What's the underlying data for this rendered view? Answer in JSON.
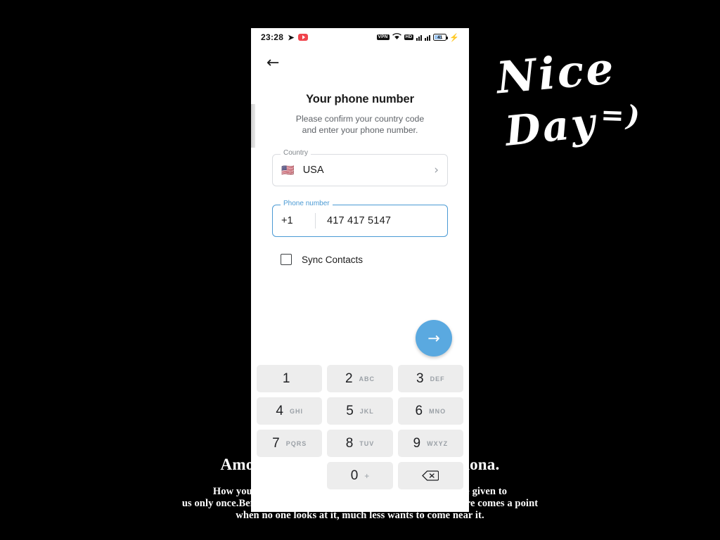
{
  "background": {
    "tagline": "Amor con amor se paga, amar perdona.",
    "paragraph_lines": [
      "How you live your life is your business, and our bodies are given to",
      "us only once.Before you know it,  health leaves ; as your body there comes a point",
      "when no one looks at it,  much less wants to come near it."
    ],
    "handwriting_line1": "Nice",
    "handwriting_line2": "Day",
    "handwriting_smiley": "=)"
  },
  "statusbar": {
    "time": "23:28",
    "telegram_icon": "telegram-icon",
    "youtube_icon": "youtube-icon",
    "vpn_label": "VPN",
    "wifi_icon": "wifi-icon",
    "hd_label": "HD",
    "signal1_icon": "signal-bars-icon",
    "signal2_icon": "signal-bars-icon",
    "battery_level": "41",
    "charging_icon": "bolt-icon"
  },
  "nav": {
    "back_label": "←"
  },
  "screen": {
    "title": "Your phone number",
    "subtitle_line1": "Please confirm your country code",
    "subtitle_line2": "and enter your phone number.",
    "country_field": {
      "label": "Country",
      "flag": "🇺🇸",
      "value": "USA",
      "chevron": "›"
    },
    "phone_field": {
      "label": "Phone number",
      "dial_code": "+1",
      "value": "417 417 5147",
      "placeholder": "Phone number"
    },
    "sync_contacts": {
      "label": "Sync Contacts",
      "checked": false
    },
    "next_button": {
      "icon": "arrow-right-icon",
      "glyph": "→",
      "color": "#5aa9e0"
    }
  },
  "keypad": {
    "rows": [
      [
        {
          "num": "1",
          "sub": ""
        },
        {
          "num": "2",
          "sub": "ABC"
        },
        {
          "num": "3",
          "sub": "DEF"
        }
      ],
      [
        {
          "num": "4",
          "sub": "GHI"
        },
        {
          "num": "5",
          "sub": "JKL"
        },
        {
          "num": "6",
          "sub": "MNO"
        }
      ],
      [
        {
          "num": "7",
          "sub": "PQRS"
        },
        {
          "num": "8",
          "sub": "TUV"
        },
        {
          "num": "9",
          "sub": "WXYZ"
        }
      ]
    ],
    "bottom": {
      "zero": "0",
      "plus": "+",
      "delete_icon": "backspace-icon"
    }
  }
}
